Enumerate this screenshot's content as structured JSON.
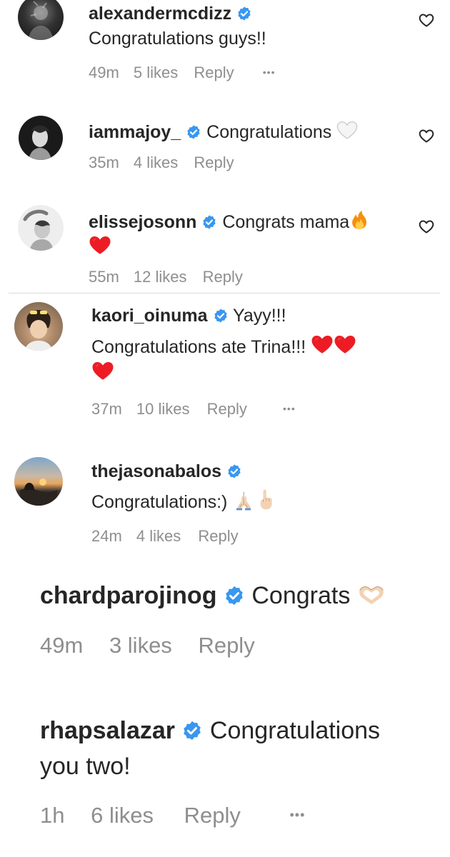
{
  "comments": [
    {
      "username": "alexandermcdizz",
      "text_lines": [
        "Congratulations guys!!"
      ],
      "time": "49m",
      "likes": "5 likes",
      "reply": "Reply",
      "more": "•••"
    },
    {
      "username": "iammajoy_",
      "text_lines": [
        "Congratulations"
      ],
      "emoji": [
        "white-heart"
      ],
      "time": "35m",
      "likes": "4 likes",
      "reply": "Reply"
    },
    {
      "username": "elissejosonn",
      "text_lines": [
        "Congrats mama"
      ],
      "emoji": [
        "fire",
        "red-heart"
      ],
      "time": "55m",
      "likes": "12 likes",
      "reply": "Reply"
    },
    {
      "username": "kaori_oinuma",
      "text_lines": [
        "Yayy!!!",
        "Congratulations ate Trina!!!"
      ],
      "emoji": [
        "red-heart",
        "red-heart",
        "red-heart"
      ],
      "time": "37m",
      "likes": "10 likes",
      "reply": "Reply",
      "more": "•••"
    },
    {
      "username": "thejasonabalos",
      "text_lines": [
        "Congratulations:)"
      ],
      "emoji": [
        "folded-hands",
        "pointing-up"
      ],
      "time": "24m",
      "likes": "4 likes",
      "reply": "Reply"
    },
    {
      "username": "chardparojinog",
      "text_lines": [
        "Congrats"
      ],
      "emoji": [
        "heart-hands"
      ],
      "time": "49m",
      "likes": "3 likes",
      "reply": "Reply"
    },
    {
      "username": "rhapsalazar",
      "text_lines": [
        "Congratulations",
        "you two!"
      ],
      "time": "1h",
      "likes": "6 likes",
      "reply": "Reply",
      "more": "•••"
    }
  ],
  "colors": {
    "text": "#262626",
    "meta": "#8e8e8e",
    "verified": "#3897f0",
    "heart": "#ed1c24",
    "divider": "#dbdbdb"
  },
  "icons": {
    "like": "heart-outline-icon",
    "verified": "verified-badge-icon"
  }
}
